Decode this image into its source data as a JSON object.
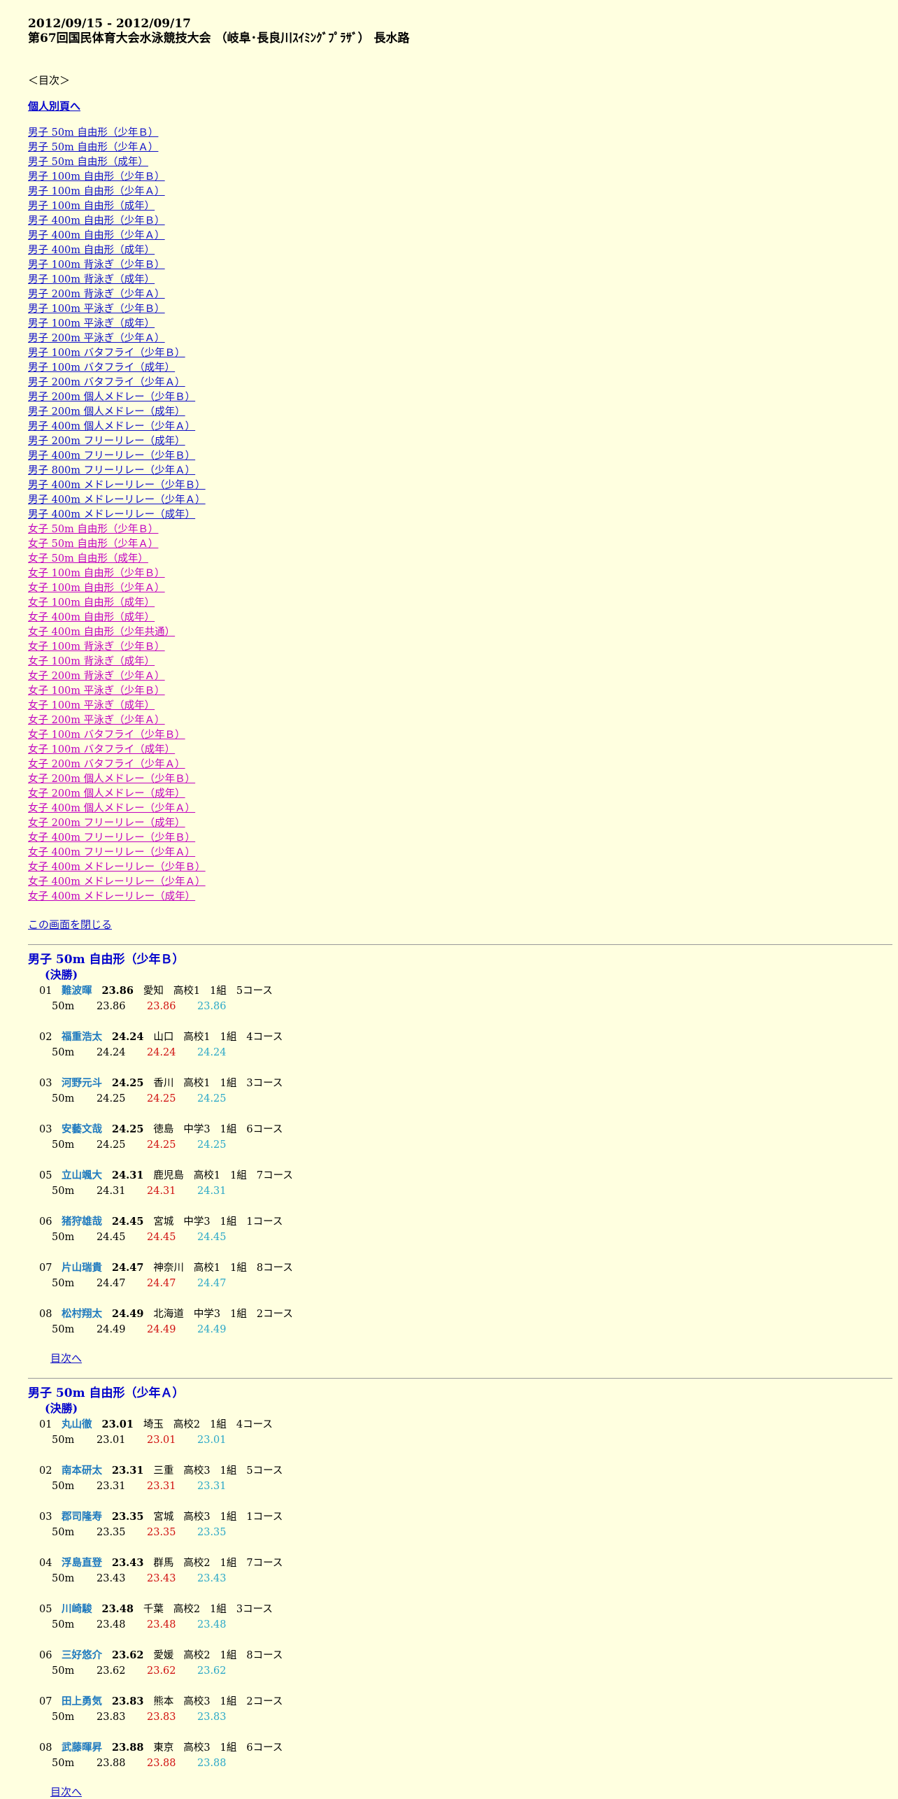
{
  "header": {
    "date": "2012/09/15 - 2012/09/17",
    "title": "第67回国民体育大会水泳競技大会 （岐阜･長良川ｽｲﾐﾝｸﾞﾌﾟﾗｻﾞ） 長水路"
  },
  "mokuji": "＜目次＞",
  "kojin_link": "個人別頁へ",
  "toc_male": [
    "男子 50m 自由形（少年Ｂ）",
    "男子 50m 自由形（少年Ａ）",
    "男子 50m 自由形（成年）",
    "男子 100m 自由形（少年Ｂ）",
    "男子 100m 自由形（少年Ａ）",
    "男子 100m 自由形（成年）",
    "男子 400m 自由形（少年Ｂ）",
    "男子 400m 自由形（少年Ａ）",
    "男子 400m 自由形（成年）",
    "男子 100m 背泳ぎ（少年Ｂ）",
    "男子 100m 背泳ぎ（成年）",
    "男子 200m 背泳ぎ（少年Ａ）",
    "男子 100m 平泳ぎ（少年Ｂ）",
    "男子 100m 平泳ぎ（成年）",
    "男子 200m 平泳ぎ（少年Ａ）",
    "男子 100m バタフライ（少年Ｂ）",
    "男子 100m バタフライ（成年）",
    "男子 200m バタフライ（少年Ａ）",
    "男子 200m 個人メドレー（少年Ｂ）",
    "男子 200m 個人メドレー（成年）",
    "男子 400m 個人メドレー（少年Ａ）",
    "男子 200m フリーリレー（成年）",
    "男子 400m フリーリレー（少年Ｂ）",
    "男子 800m フリーリレー（少年Ａ）",
    "男子 400m メドレーリレー（少年Ｂ）",
    "男子 400m メドレーリレー（少年Ａ）",
    "男子 400m メドレーリレー（成年）"
  ],
  "toc_female": [
    "女子 50m 自由形（少年Ｂ）",
    "女子 50m 自由形（少年Ａ）",
    "女子 50m 自由形（成年）",
    "女子 100m 自由形（少年Ｂ）",
    "女子 100m 自由形（少年Ａ）",
    "女子 100m 自由形（成年）",
    "女子 400m 自由形（成年）",
    "女子 400m 自由形（少年共通）",
    "女子 100m 背泳ぎ（少年Ｂ）",
    "女子 100m 背泳ぎ（成年）",
    "女子 200m 背泳ぎ（少年Ａ）",
    "女子 100m 平泳ぎ（少年Ｂ）",
    "女子 100m 平泳ぎ（成年）",
    "女子 200m 平泳ぎ（少年Ａ）",
    "女子 100m バタフライ（少年Ｂ）",
    "女子 100m バタフライ（成年）",
    "女子 200m バタフライ（少年Ａ）",
    "女子 200m 個人メドレー（少年Ｂ）",
    "女子 200m 個人メドレー（成年）",
    "女子 400m 個人メドレー（少年Ａ）",
    "女子 200m フリーリレー（成年）",
    "女子 400m フリーリレー（少年Ｂ）",
    "女子 400m フリーリレー（少年Ａ）",
    "女子 400m メドレーリレー（少年Ｂ）",
    "女子 400m メドレーリレー（少年Ａ）",
    "女子 400m メドレーリレー（成年）"
  ],
  "close_link": "この画面を閉じる",
  "back_link": "目次へ",
  "events": [
    {
      "title": "男子 50m 自由形（少年Ｂ）",
      "round": "(決勝)",
      "entries": [
        {
          "rank": "01",
          "name": "難波暉",
          "time": "23.86",
          "pref": "愛知",
          "grade": "高校1",
          "heat": "1組",
          "lane": "5コース",
          "dist": "50m",
          "t1": "23.86",
          "t2": "23.86",
          "t3": "23.86"
        },
        {
          "rank": "02",
          "name": "福重浩太",
          "time": "24.24",
          "pref": "山口",
          "grade": "高校1",
          "heat": "1組",
          "lane": "4コース",
          "dist": "50m",
          "t1": "24.24",
          "t2": "24.24",
          "t3": "24.24"
        },
        {
          "rank": "03",
          "name": "河野元斗",
          "time": "24.25",
          "pref": "香川",
          "grade": "高校1",
          "heat": "1組",
          "lane": "3コース",
          "dist": "50m",
          "t1": "24.25",
          "t2": "24.25",
          "t3": "24.25"
        },
        {
          "rank": "03",
          "name": "安藝文哉",
          "time": "24.25",
          "pref": "徳島",
          "grade": "中学3",
          "heat": "1組",
          "lane": "6コース",
          "dist": "50m",
          "t1": "24.25",
          "t2": "24.25",
          "t3": "24.25"
        },
        {
          "rank": "05",
          "name": "立山颯大",
          "time": "24.31",
          "pref": "鹿児島",
          "grade": "高校1",
          "heat": "1組",
          "lane": "7コース",
          "dist": "50m",
          "t1": "24.31",
          "t2": "24.31",
          "t3": "24.31"
        },
        {
          "rank": "06",
          "name": "猪狩雄哉",
          "time": "24.45",
          "pref": "宮城",
          "grade": "中学3",
          "heat": "1組",
          "lane": "1コース",
          "dist": "50m",
          "t1": "24.45",
          "t2": "24.45",
          "t3": "24.45"
        },
        {
          "rank": "07",
          "name": "片山瑞貴",
          "time": "24.47",
          "pref": "神奈川",
          "grade": "高校1",
          "heat": "1組",
          "lane": "8コース",
          "dist": "50m",
          "t1": "24.47",
          "t2": "24.47",
          "t3": "24.47"
        },
        {
          "rank": "08",
          "name": "松村翔太",
          "time": "24.49",
          "pref": "北海道",
          "grade": "中学3",
          "heat": "1組",
          "lane": "2コース",
          "dist": "50m",
          "t1": "24.49",
          "t2": "24.49",
          "t3": "24.49"
        }
      ]
    },
    {
      "title": "男子 50m 自由形（少年Ａ）",
      "round": "(決勝)",
      "entries": [
        {
          "rank": "01",
          "name": "丸山徹",
          "time": "23.01",
          "pref": "埼玉",
          "grade": "高校2",
          "heat": "1組",
          "lane": "4コース",
          "dist": "50m",
          "t1": "23.01",
          "t2": "23.01",
          "t3": "23.01"
        },
        {
          "rank": "02",
          "name": "南本研太",
          "time": "23.31",
          "pref": "三重",
          "grade": "高校3",
          "heat": "1組",
          "lane": "5コース",
          "dist": "50m",
          "t1": "23.31",
          "t2": "23.31",
          "t3": "23.31"
        },
        {
          "rank": "03",
          "name": "郡司隆寿",
          "time": "23.35",
          "pref": "宮城",
          "grade": "高校3",
          "heat": "1組",
          "lane": "1コース",
          "dist": "50m",
          "t1": "23.35",
          "t2": "23.35",
          "t3": "23.35"
        },
        {
          "rank": "04",
          "name": "浮島直登",
          "time": "23.43",
          "pref": "群馬",
          "grade": "高校2",
          "heat": "1組",
          "lane": "7コース",
          "dist": "50m",
          "t1": "23.43",
          "t2": "23.43",
          "t3": "23.43"
        },
        {
          "rank": "05",
          "name": "川崎駿",
          "time": "23.48",
          "pref": "千葉",
          "grade": "高校2",
          "heat": "1組",
          "lane": "3コース",
          "dist": "50m",
          "t1": "23.48",
          "t2": "23.48",
          "t3": "23.48"
        },
        {
          "rank": "06",
          "name": "三好悠介",
          "time": "23.62",
          "pref": "愛媛",
          "grade": "高校2",
          "heat": "1組",
          "lane": "8コース",
          "dist": "50m",
          "t1": "23.62",
          "t2": "23.62",
          "t3": "23.62"
        },
        {
          "rank": "07",
          "name": "田上勇気",
          "time": "23.83",
          "pref": "熊本",
          "grade": "高校3",
          "heat": "1組",
          "lane": "2コース",
          "dist": "50m",
          "t1": "23.83",
          "t2": "23.83",
          "t3": "23.83"
        },
        {
          "rank": "08",
          "name": "武藤暉昇",
          "time": "23.88",
          "pref": "東京",
          "grade": "高校3",
          "heat": "1組",
          "lane": "6コース",
          "dist": "50m",
          "t1": "23.88",
          "t2": "23.88",
          "t3": "23.88"
        }
      ]
    }
  ]
}
